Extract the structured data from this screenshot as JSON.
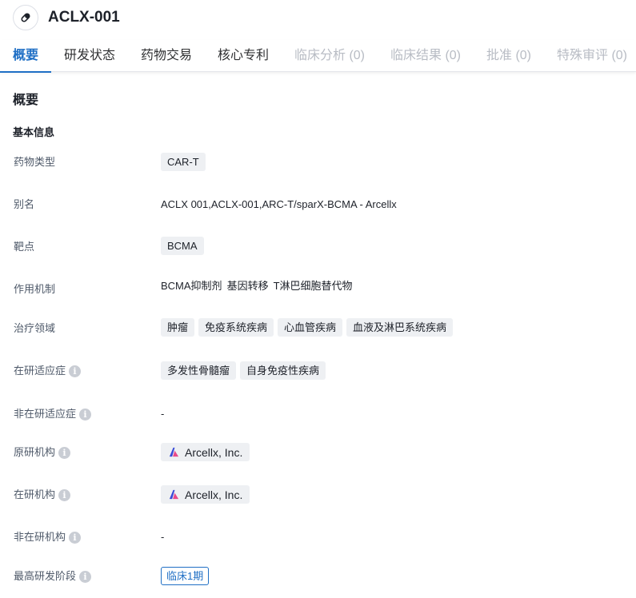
{
  "header": {
    "title": "ACLX-001",
    "icon": "pill-icon"
  },
  "tabs": [
    {
      "label": "概要",
      "state": "active"
    },
    {
      "label": "研发状态",
      "state": "normal"
    },
    {
      "label": "药物交易",
      "state": "normal"
    },
    {
      "label": "核心专利",
      "state": "normal"
    },
    {
      "label": "临床分析 (0)",
      "state": "disabled"
    },
    {
      "label": "临床结果 (0)",
      "state": "disabled"
    },
    {
      "label": "批准 (0)",
      "state": "disabled"
    },
    {
      "label": "特殊审评 (0)",
      "state": "disabled"
    }
  ],
  "overview": {
    "title": "概要",
    "basic_info_title": "基本信息",
    "drug_type": {
      "label": "药物类型",
      "tags": [
        "CAR-T"
      ]
    },
    "alias": {
      "label": "别名",
      "value": "ACLX 001,ACLX-001,ARC-T/sparX-BCMA - Arcellx"
    },
    "target": {
      "label": "靶点",
      "tags": [
        "BCMA"
      ]
    },
    "mechanism": {
      "label": "作用机制",
      "items": [
        "BCMA抑制剂",
        "基因转移",
        "T淋巴细胞替代物"
      ]
    },
    "therapeutic_area": {
      "label": "治疗领域",
      "tags": [
        "肿瘤",
        "免疫系统疾病",
        "心血管疾病",
        "血液及淋巴系统疾病"
      ]
    },
    "active_indication": {
      "label": "在研适应症",
      "tags": [
        "多发性骨髓瘤",
        "自身免疫性疾病"
      ]
    },
    "inactive_indication": {
      "label": "非在研适应症",
      "value": "-"
    },
    "originator": {
      "label": "原研机构",
      "org": "Arcellx, Inc."
    },
    "active_org": {
      "label": "在研机构",
      "org": "Arcellx, Inc."
    },
    "inactive_org": {
      "label": "非在研机构",
      "value": "-"
    },
    "highest_phase": {
      "label": "最高研发阶段",
      "value": "临床1期"
    }
  },
  "colors": {
    "accent": "#1f6fc5",
    "tag_bg": "#eef0f3",
    "disabled_tab": "#b8bcc4"
  }
}
